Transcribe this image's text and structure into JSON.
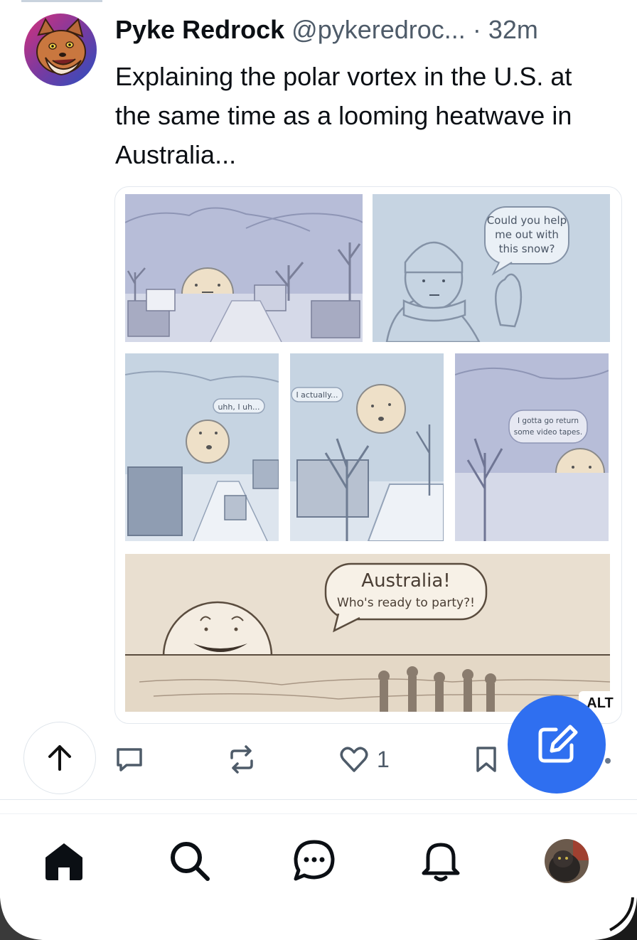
{
  "post": {
    "author_name": "Pyke Redrock",
    "author_handle": "@pykeredroc...",
    "separator": "·",
    "time": "32m",
    "text": "Explaining the polar vortex in the U.S. at the same time as a looming heatwave in Australia...",
    "image": {
      "panel2_bubble": [
        "Could you help",
        "me out with",
        "this snow?"
      ],
      "panel3_bubble": "uhh, I uh...",
      "panel4_bubble": "I actually...",
      "panel5_bubble": [
        "I gotta go return",
        "some video tapes."
      ],
      "panel6_bubble_title": "Australia!",
      "panel6_bubble_sub": "Who's ready to party?!"
    },
    "alt_badge": "ALT",
    "like_count": "1"
  },
  "icons": {
    "avatar": "avatar-icon",
    "scroll_top": "arrow-up-icon",
    "reply": "reply-icon",
    "repost": "repost-icon",
    "like": "heart-icon",
    "bookmark": "bookmark-icon",
    "compose": "compose-icon",
    "home": "home-icon",
    "search": "search-icon",
    "chat": "chat-icon",
    "notifications": "bell-icon",
    "profile": "profile-avatar-icon"
  },
  "colors": {
    "accent": "#2f6ff0",
    "secondary_text": "#4e5b69",
    "panel_blue": "#c6d4e2",
    "panel_lavender": "#b7bdd8",
    "panel_sand": "#e9dfd0"
  }
}
